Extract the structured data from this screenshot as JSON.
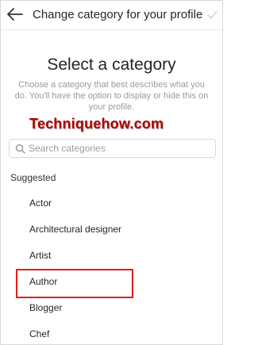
{
  "header": {
    "title": "Change category for your profile",
    "back_icon": "arrow-left-icon",
    "confirm_icon": "checkmark-icon"
  },
  "main": {
    "heading": "Select a category",
    "description": "Choose a category that best describes what you do. You'll have the option to display or hide this on your profile.",
    "watermark": "Techniquehow.com"
  },
  "search": {
    "placeholder": "Search categories",
    "value": "",
    "icon": "search-icon"
  },
  "section": {
    "label": "Suggested"
  },
  "categories": [
    {
      "label": "Actor"
    },
    {
      "label": "Architectural designer"
    },
    {
      "label": "Artist"
    },
    {
      "label": "Author"
    },
    {
      "label": "Blogger"
    },
    {
      "label": "Chef"
    }
  ],
  "colors": {
    "text": "#262626",
    "muted": "#9a9a9a",
    "border": "#d8d8d8",
    "highlight": "#e11d1d",
    "watermark": "#b10000"
  }
}
